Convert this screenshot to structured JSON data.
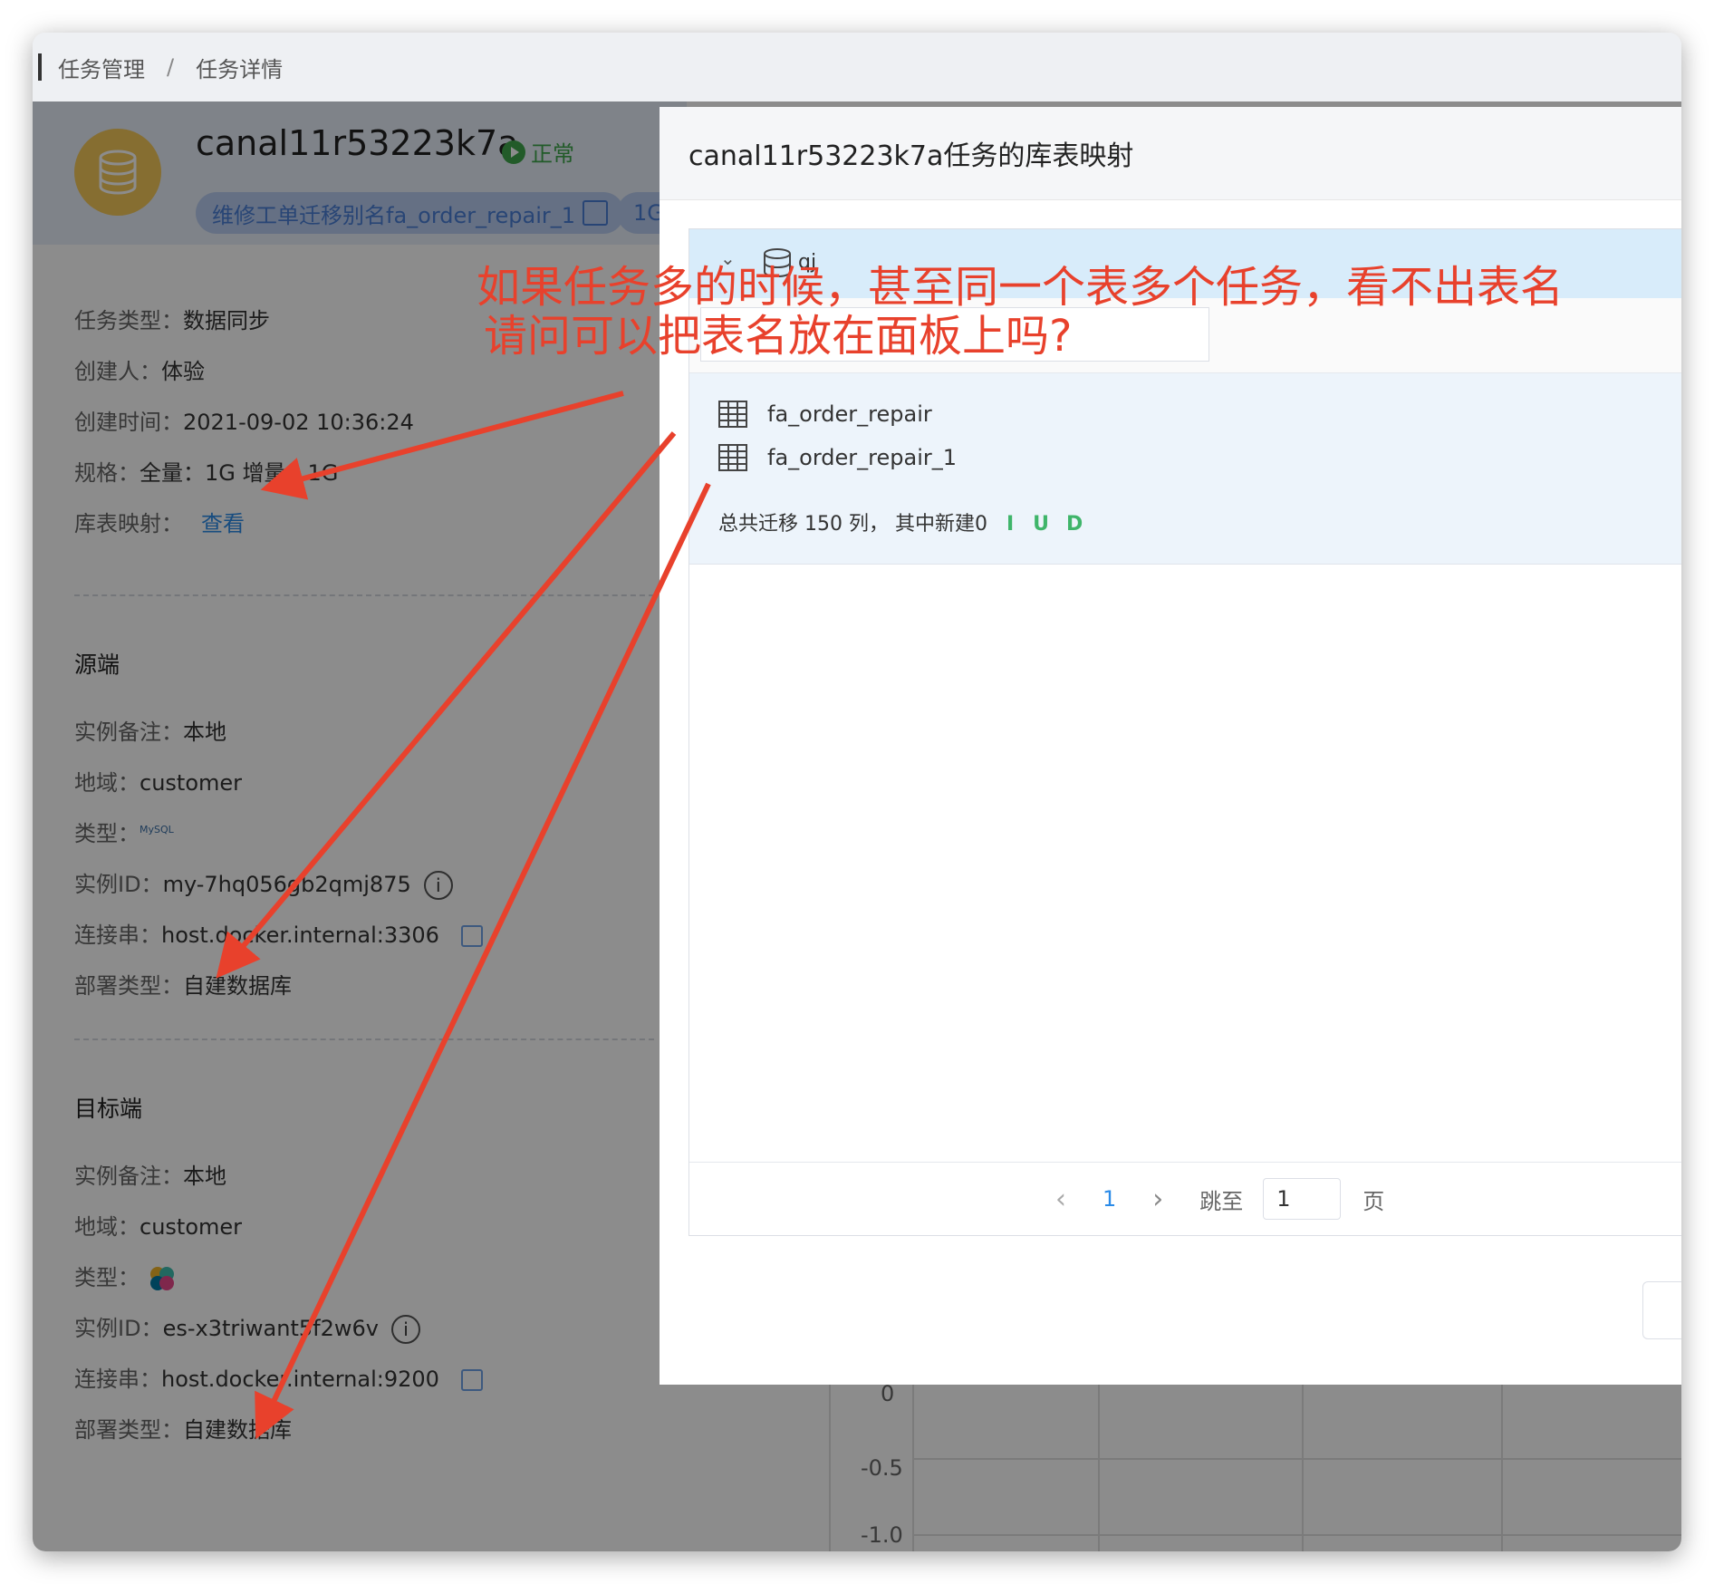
{
  "breadcrumb": {
    "parent": "任务管理",
    "separator": "/",
    "current": "任务详情"
  },
  "task": {
    "name": "canal11r53223k7a",
    "status": "正常",
    "alias": "维修工单迁移别名fa_order_repair_1",
    "spec_tag": "1G"
  },
  "info": {
    "task_type_label": "任务类型：",
    "task_type": "数据同步",
    "creator_label": "创建人：",
    "creator": "体验",
    "created_label": "创建时间：",
    "created": "2021-09-02 10:36:24",
    "spec_label": "规格：",
    "spec": "全量：1G 增量：1G",
    "mapping_label": "库表映射：",
    "mapping_link": "查看"
  },
  "source": {
    "title": "源端",
    "remark_label": "实例备注：",
    "remark": "本地",
    "region_label": "地域：",
    "region": "customer",
    "type_label": "类型：",
    "type_icon": "mysql-icon",
    "instance_label": "实例ID：",
    "instance": "my-7hq056gb2qmj875",
    "conn_label": "连接串：",
    "conn": "host.docker.internal:3306",
    "deploy_label": "部署类型：",
    "deploy": "自建数据库"
  },
  "target": {
    "title": "目标端",
    "remark_label": "实例备注：",
    "remark": "本地",
    "region_label": "地域：",
    "region": "customer",
    "type_label": "类型：",
    "type_icon": "elasticsearch-icon",
    "instance_label": "实例ID：",
    "instance": "es-x3triwant5f2w6v",
    "conn_label": "连接串：",
    "conn": "host.docker.internal:9200",
    "deploy_label": "部署类型：",
    "deploy": "自建数据库"
  },
  "chart_axis": {
    "tick_0": "0",
    "tick_neg05": "-0.5",
    "tick_neg1": "-1.0"
  },
  "modal": {
    "title": "canal11r53223k7a任务的库表映射",
    "db_name": "qj",
    "tables": [
      "fa_order_repair",
      "fa_order_repair_1"
    ],
    "summary": "总共迁移 150 列， 其中新建0",
    "iud": {
      "i": "I",
      "u": "U",
      "d": "D"
    },
    "pager": {
      "prev": "‹",
      "page": "1",
      "next": "›",
      "jump_label": "跳至",
      "jump_value": "1",
      "page_suffix": "页"
    }
  },
  "annotation": {
    "line1": "如果任务多的时候，甚至同一个表多个任务，看不出表名",
    "line2": "请问可以把表名放在面板上吗?"
  },
  "colors": {
    "annotation": "#e8412c",
    "link": "#2b8be8",
    "status": "#3fa64b",
    "selected_row": "#d8ecfa"
  }
}
